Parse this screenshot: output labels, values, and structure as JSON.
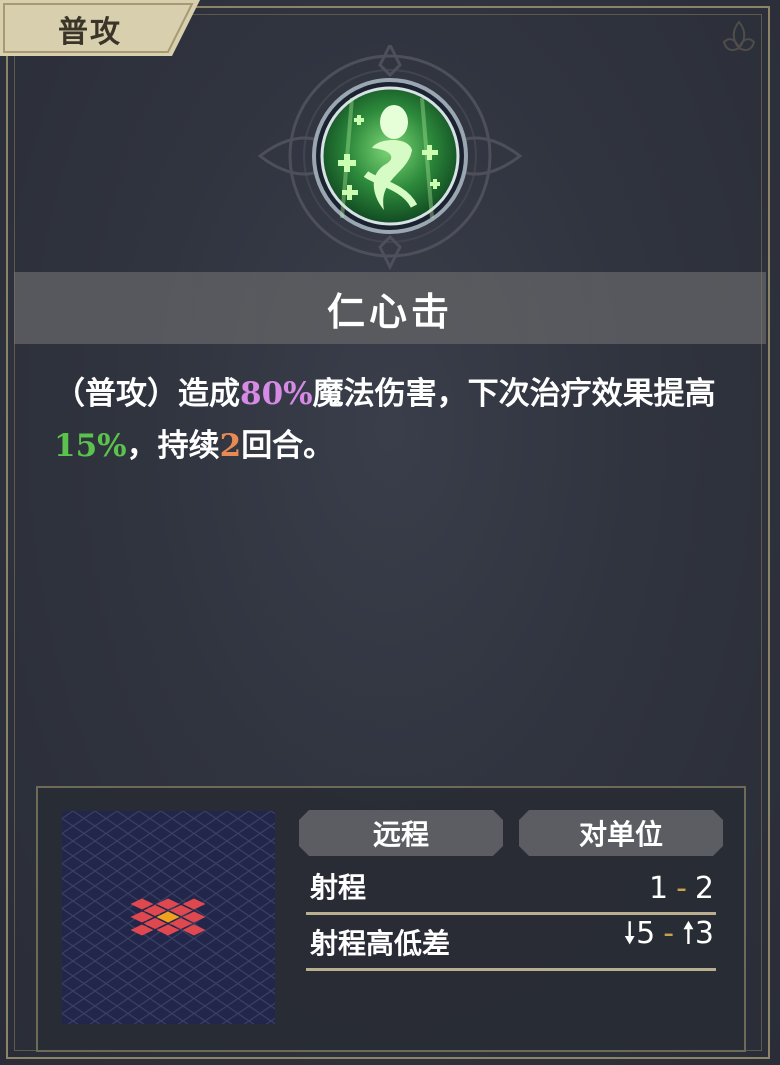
{
  "tab": {
    "label": "普攻"
  },
  "skill": {
    "name": "仁心击",
    "icon": "healing-figure-icon",
    "description": {
      "p1": "（普攻）造成",
      "damage_pct": "80%",
      "p2": "魔法伤害，下次治疗效果提高",
      "heal_pct": "15%",
      "p3": "，持续",
      "turns": "2",
      "p4": "回合。"
    }
  },
  "attack": {
    "type_label": "远程",
    "target_label": "对单位",
    "range_label": "射程",
    "range_min": "1",
    "range_max": "2",
    "height_label": "射程高低差",
    "height_down": "5",
    "height_up": "3",
    "down_arrow": "🠗",
    "up_arrow": "🠕"
  },
  "colors": {
    "damage": "#d58ae6",
    "heal": "#5cc24e",
    "turns": "#e78a53",
    "tile_range": "#e0484f",
    "tile_center": "#f0a21f"
  }
}
